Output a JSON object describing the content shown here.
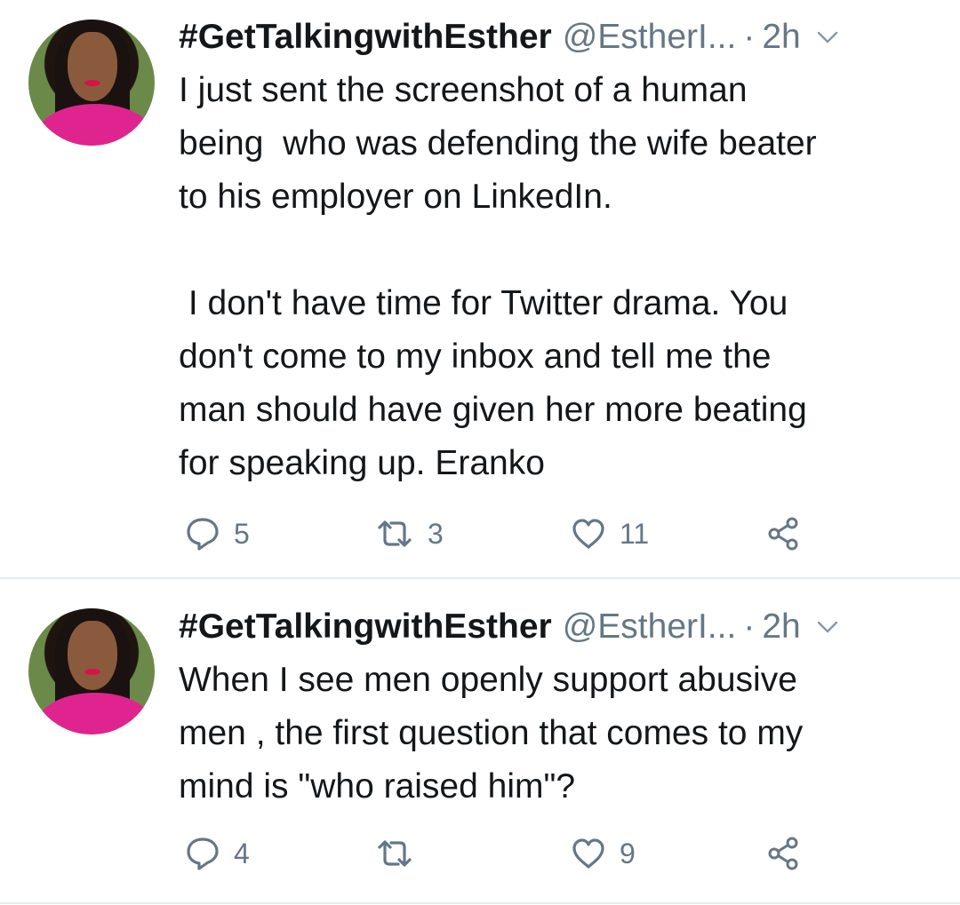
{
  "colors": {
    "text": "#14171a",
    "secondary": "#657786",
    "divider": "#e6ecf0",
    "background": "#ffffff"
  },
  "tweets": [
    {
      "name": "#GetTalkingwithEsther",
      "handle": "@EstherI...",
      "separator": "·",
      "time": "2h",
      "text": "I just sent the screenshot of a human\nbeing  who was defending the wife beater\nto his employer on LinkedIn.\n\n I don't have time for Twitter drama. You\ndon't come to my inbox and tell me the\nman should have given her more beating\nfor speaking up. Eranko",
      "replies": "5",
      "retweets": "3",
      "likes": "11",
      "icons": [
        "reply-icon",
        "retweet-icon",
        "like-icon",
        "share-icon",
        "chevron-down-icon"
      ]
    },
    {
      "name": "#GetTalkingwithEsther",
      "handle": "@EstherI...",
      "separator": "·",
      "time": "2h",
      "text": "When I see men openly support abusive\nmen , the first question that comes to my\nmind is \"who raised him\"?",
      "replies": "4",
      "retweets": "",
      "likes": "9",
      "icons": [
        "reply-icon",
        "retweet-icon",
        "like-icon",
        "share-icon",
        "chevron-down-icon"
      ]
    }
  ]
}
